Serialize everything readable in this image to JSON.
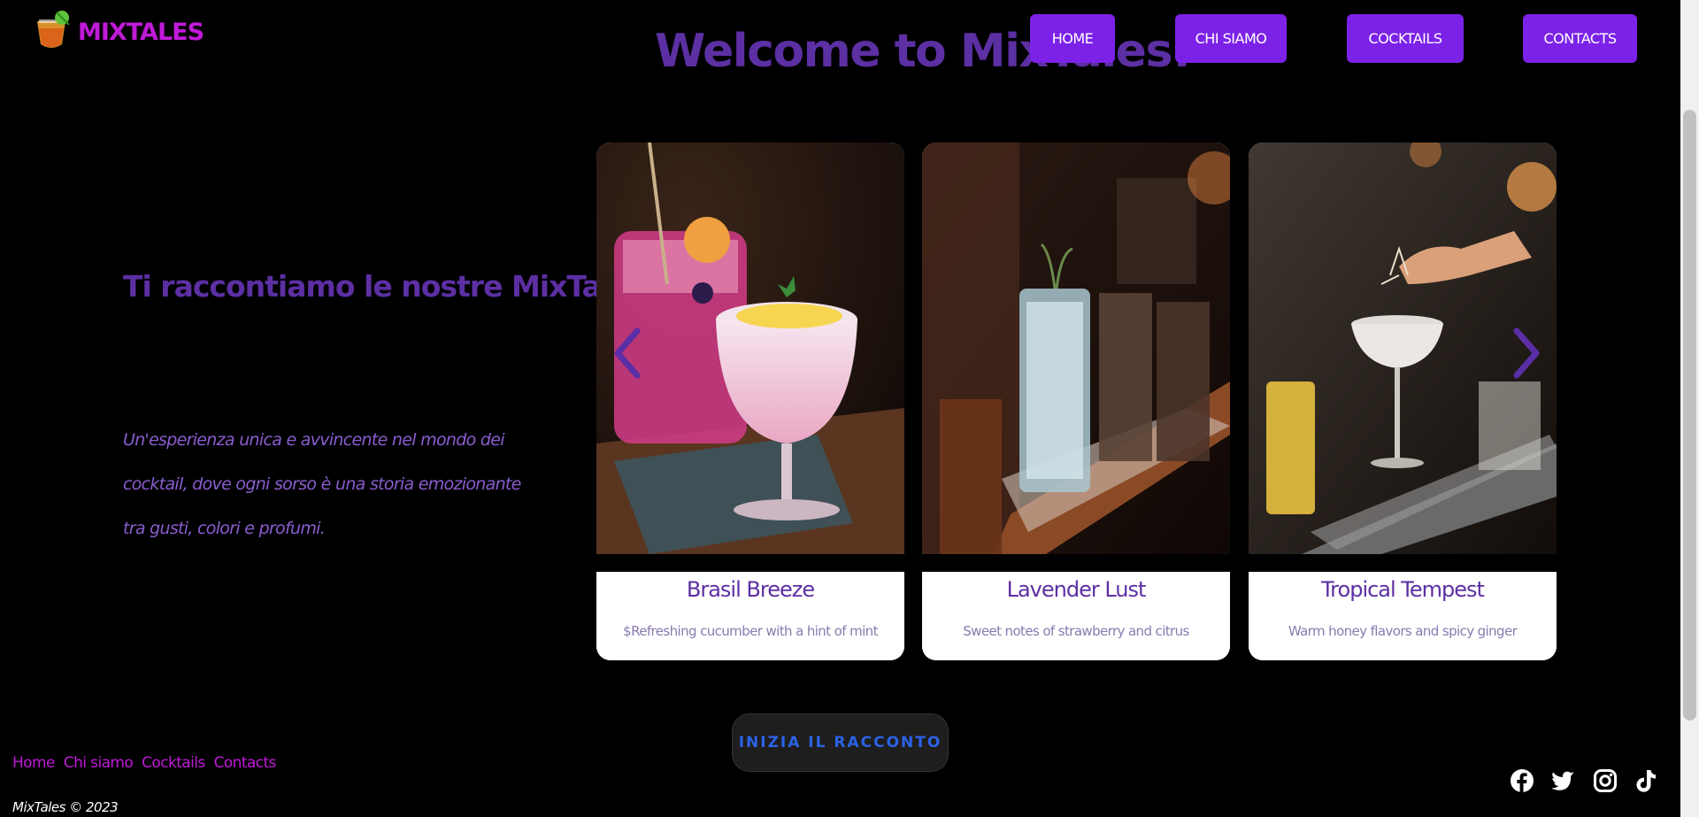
{
  "header": {
    "logo_text": "MIXTALES",
    "logo_icon": "cocktail-glass-icon",
    "welcome": "Welcome to MixTales!"
  },
  "nav": {
    "items": [
      {
        "label": "HOME"
      },
      {
        "label": "CHI SIAMO"
      },
      {
        "label": "COCKTAILS"
      },
      {
        "label": "CONTACTS"
      }
    ]
  },
  "hero": {
    "tagline": "Ti raccontiamo le nostre MixTales",
    "description": "Un'esperienza unica e avvincente nel mondo dei cocktail, dove ogni sorso è una storia emozionante tra gusti, colori e profumi."
  },
  "carousel": {
    "prev_icon": "chevron-left-icon",
    "next_icon": "chevron-right-icon",
    "cards": [
      {
        "title": "Brasil Breeze",
        "subtitle": "$Refreshing cucumber with a hint of mint"
      },
      {
        "title": "Lavender Lust",
        "subtitle": "Sweet notes of strawberry and citrus"
      },
      {
        "title": "Tropical Tempest",
        "subtitle": "Warm honey flavors and spicy ginger"
      }
    ]
  },
  "cta": {
    "label": "INIZIA IL RACCONTO"
  },
  "footer": {
    "links": [
      "Home",
      "Chi siamo",
      "Cocktails",
      "Contacts"
    ],
    "copyright": "MixTales © 2023",
    "social_icons": [
      "facebook-icon",
      "twitter-icon",
      "instagram-icon",
      "tiktok-icon"
    ]
  },
  "colors": {
    "brand_magenta": "#c01ad9",
    "brand_purple": "#5c2fa3",
    "nav_button": "#7c22e8",
    "cta_text": "#2b62e6",
    "background": "#000000"
  }
}
